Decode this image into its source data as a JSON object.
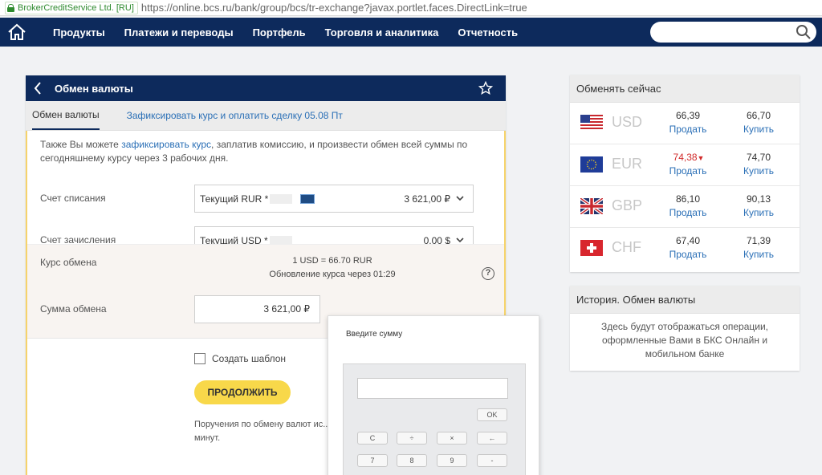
{
  "browser": {
    "certificate": "BrokerCreditService Ltd. [RU]",
    "url": "https://online.bcs.ru/bank/group/bcs/tr-exchange?javax.portlet.faces.DirectLink=true"
  },
  "nav": {
    "items": [
      "Продукты",
      "Платежи и переводы",
      "Портфель",
      "Торговля и аналитика",
      "Отчетность"
    ],
    "search_placeholder": ""
  },
  "panel": {
    "title": "Обмен валюты",
    "tabs": {
      "active": "Обмен валюты",
      "link": "Зафиксировать курс и оплатить сделку 05.08 Пт"
    },
    "info": {
      "before": "Также Вы можете ",
      "link": "зафиксировать курс",
      "after": ", заплатив комиссию, и произвести обмен всей суммы по сегодняшнему курсу через 3 рабочих дня."
    },
    "debit": {
      "label": "Счет списания",
      "account": "Текущий RUR *",
      "amount": "3 621,00 ₽"
    },
    "credit": {
      "label": "Счет зачисления",
      "account": "Текущий USD *",
      "amount": "0,00 $"
    },
    "rate": {
      "label": "Курс обмена",
      "value": "1 USD = 66.70 RUR",
      "update": "Обновление курса через 01:29",
      "help": "?"
    },
    "sum": {
      "label": "Сумма обмена",
      "value": "3 621,00 ₽"
    },
    "template_label": "Создать шаблон",
    "continue_label": "ПРОДОЛЖИТЬ",
    "note": "Поручения по обмену валют ис... минут."
  },
  "calculator": {
    "title": "Введите сумму",
    "ok": "OK",
    "keys_row1": [
      "C",
      "÷",
      "×",
      "←"
    ],
    "keys_row2": [
      "7",
      "8",
      "9",
      "-"
    ]
  },
  "exchange": {
    "title": "Обменять сейчас",
    "rows": [
      {
        "code": "USD",
        "sell": "66,39",
        "buy": "66,70",
        "sell_link": "Продать",
        "buy_link": "Купить",
        "down": false
      },
      {
        "code": "EUR",
        "sell": "74,38",
        "buy": "74,70",
        "sell_link": "Продать",
        "buy_link": "Купить",
        "down": true
      },
      {
        "code": "GBP",
        "sell": "86,10",
        "buy": "90,13",
        "sell_link": "Продать",
        "buy_link": "Купить",
        "down": false
      },
      {
        "code": "CHF",
        "sell": "67,40",
        "buy": "71,39",
        "sell_link": "Продать",
        "buy_link": "Купить",
        "down": false
      }
    ]
  },
  "history": {
    "title": "История. Обмен валюты",
    "text": "Здесь будут отображаться операции, оформленные Вами в БКС Онлайн и мобильном банке"
  },
  "colors": {
    "nav": "#0d2a5c",
    "accent": "#f8d84a",
    "link": "#2a6fb6",
    "down": "#d12a2a"
  }
}
